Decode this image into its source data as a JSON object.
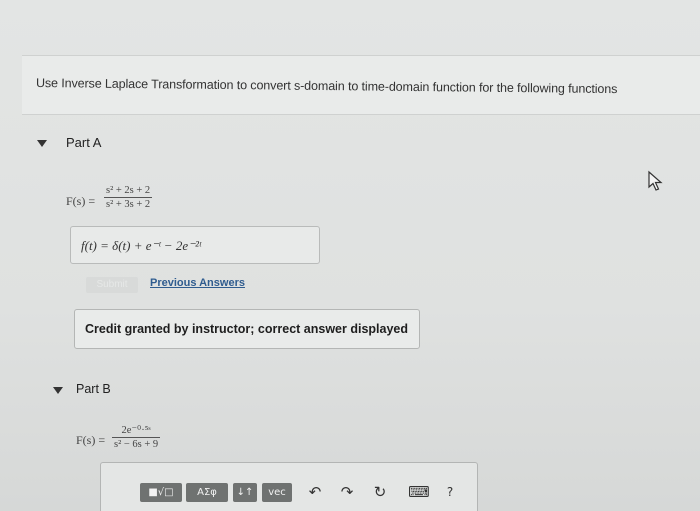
{
  "instruction": "Use Inverse Laplace Transformation to convert s-domain to time-domain function for the following functions",
  "part_a": {
    "title": "Part A",
    "fs_label": "F(s) =",
    "numerator": "s² + 2s + 2",
    "denominator": "s² + 3s + 2",
    "answer": "f(t) = δ(t) + e⁻ᵗ − 2e⁻²ᵗ",
    "submit_label": "Submit",
    "previous_answers_label": "Previous Answers",
    "credit_text": "Credit granted by instructor; correct answer displayed"
  },
  "part_b": {
    "title": "Part B",
    "fs_label": "F(s) =",
    "numerator": "2e⁻⁰·⁵ˢ",
    "denominator": "s² − 6s + 9"
  },
  "toolbar": {
    "templates_label": "■√□",
    "greek_label": "ΑΣφ",
    "arrows_label": "↓↑",
    "vec_label": "vec",
    "undo_icon": "↶",
    "redo_icon": "↷",
    "reset_icon": "↻",
    "keyboard_icon": "⌨",
    "help_label": "?"
  },
  "colors": {
    "link": "#2f5c8f",
    "toolbar_button": "#6f7271"
  }
}
